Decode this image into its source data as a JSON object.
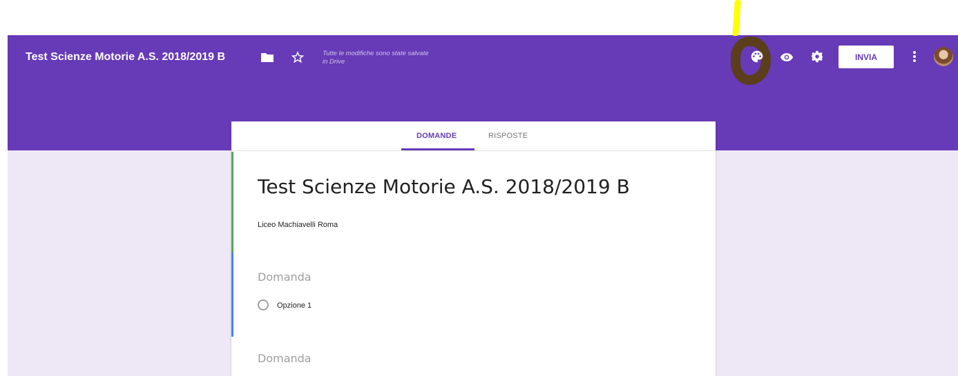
{
  "header": {
    "form_title": "Test Scienze Motorie A.S. 2018/2019 B",
    "save_status": "Tutte le modifiche sono state salvate in Drive",
    "send_button_label": "INVIA",
    "icons": [
      "back-arrow-icon",
      "folder-icon",
      "star-icon",
      "palette-icon",
      "eye-icon",
      "gear-icon",
      "more-vert-icon"
    ],
    "accent_color": "#673ab7"
  },
  "tabs": [
    {
      "label": "DOMANDE",
      "active": true
    },
    {
      "label": "RISPOSTE",
      "active": false
    }
  ],
  "form": {
    "title": "Test Scienze Motorie A.S. 2018/2019 B",
    "description": "Liceo Machiavelli Roma",
    "questions": [
      {
        "placeholder": "Domanda",
        "options": [
          "Opzione 1"
        ]
      },
      {
        "placeholder": "Domanda"
      }
    ]
  },
  "annotation": {
    "marker_colors": [
      "#ffff00",
      "#5b3e12"
    ]
  }
}
